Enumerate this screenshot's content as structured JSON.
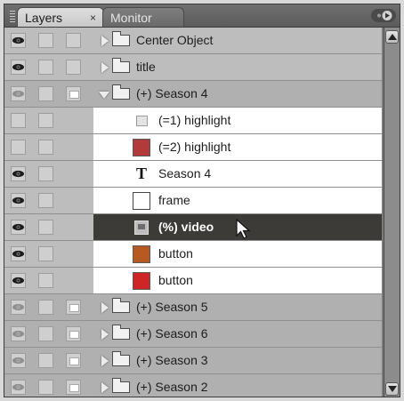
{
  "tabs": [
    {
      "label": "Layers",
      "active": true,
      "close": "×"
    },
    {
      "label": "Monitor",
      "active": false
    }
  ],
  "layers": [
    {
      "name": "Center Object",
      "kind": "folder",
      "expanded": false,
      "eye": true,
      "tag": false
    },
    {
      "name": "title",
      "kind": "folder",
      "expanded": false,
      "eye": true,
      "tag": false
    },
    {
      "name": "(+) Season 4",
      "kind": "folder",
      "expanded": true,
      "eye": false,
      "tag": true
    },
    {
      "name": "(=1) highlight",
      "kind": "child",
      "icon": "small-square-icon",
      "eye": null
    },
    {
      "name": "(=2) highlight",
      "kind": "child",
      "icon": "color-swatch-icon",
      "color": "#b23a3a",
      "eye": null
    },
    {
      "name": "Season 4",
      "kind": "child",
      "icon": "text-layer-icon",
      "glyph": "T",
      "eye": true
    },
    {
      "name": "frame",
      "kind": "child",
      "icon": "frame-swatch-icon",
      "eye": true
    },
    {
      "name": "(%) video",
      "kind": "child",
      "icon": "video-layer-icon",
      "eye": true,
      "selected": true
    },
    {
      "name": "button",
      "kind": "child",
      "icon": "color-swatch-icon",
      "color": "#b65a22",
      "eye": true
    },
    {
      "name": "button",
      "kind": "child",
      "icon": "color-swatch-icon",
      "color": "#cf2525",
      "eye": true
    },
    {
      "name": "(+) Season 5",
      "kind": "folder",
      "expanded": false,
      "eye": false,
      "tag": true
    },
    {
      "name": "(+) Season 6",
      "kind": "folder",
      "expanded": false,
      "eye": false,
      "tag": true
    },
    {
      "name": "(+) Season 3",
      "kind": "folder",
      "expanded": false,
      "eye": false,
      "tag": true
    },
    {
      "name": "(+) Season 2",
      "kind": "folder",
      "expanded": false,
      "eye": false,
      "tag": true
    }
  ],
  "icons": {
    "visibility": "eye-icon",
    "lock": "lock-box-icon",
    "folder": "folder-icon",
    "cursor": "mouse-pointer-icon",
    "menu": "panel-menu-icon"
  }
}
